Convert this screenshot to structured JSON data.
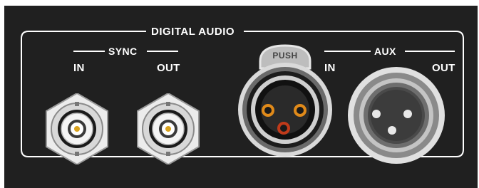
{
  "section": {
    "title": "DIGITAL AUDIO"
  },
  "sync": {
    "title": "SYNC",
    "in_label": "IN",
    "out_label": "OUT"
  },
  "aux": {
    "title": "AUX",
    "in_label": "IN",
    "out_label": "OUT"
  },
  "xlr_in": {
    "push_label": "PUSH"
  },
  "colors": {
    "panel": "#202020",
    "line": "#ffffff",
    "bnc_body": "#e6e6e6",
    "pin_ring": "#e08a1a",
    "pin_center": "#c03a1a"
  },
  "icons": [
    "bnc-connector-icon",
    "xlr-female-connector-icon",
    "xlr-male-connector-icon"
  ]
}
